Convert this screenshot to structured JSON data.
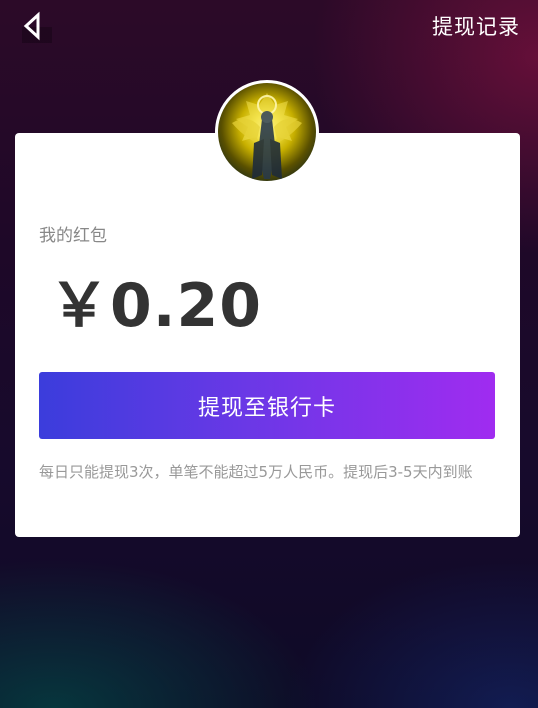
{
  "header": {
    "withdraw_history_label": "提现记录"
  },
  "wallet": {
    "label": "我的红包",
    "amount": "￥0.20"
  },
  "actions": {
    "withdraw_to_bank_label": "提现至银行卡"
  },
  "notice": {
    "text": "每日只能提现3次，单笔不能超过5万人民币。提现后3-5天内到账"
  },
  "icons": {
    "back": "back-arrow-icon",
    "avatar": "user-avatar"
  },
  "colors": {
    "button_gradient_start": "#3b3ddc",
    "button_gradient_end": "#a02cf0",
    "card_background": "#ffffff",
    "amount_text": "#333333"
  }
}
